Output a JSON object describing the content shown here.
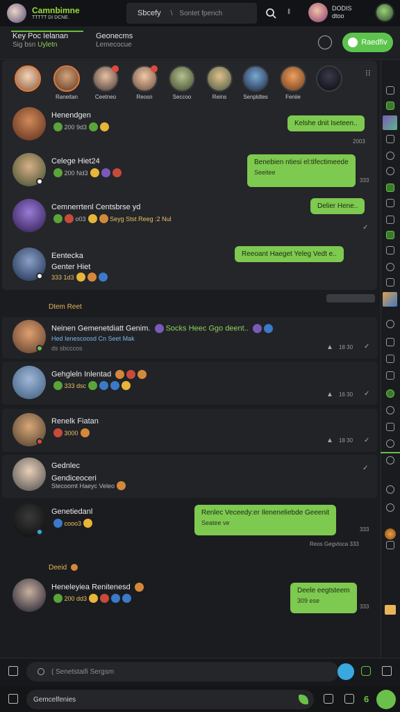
{
  "app": {
    "title": "Camnbimne",
    "subtitle": "TTTTT DI DCNE."
  },
  "topbar": {
    "search_label": "Sbcefy",
    "search_placeholder": "Sontet fpench",
    "search_glyph": "\\",
    "pause_glyph": "‖",
    "user_line1": "DODIS",
    "user_line2": "dtoo"
  },
  "tabs": [
    {
      "line1": "Key Poc Ielanan",
      "line2_a": "Sig bsn",
      "line2_b": "Uyletn"
    },
    {
      "line1": "Geonecms",
      "line2_a": "Lemecocue",
      "line2_b": ""
    }
  ],
  "ready_button": "Raedfiv",
  "stories": [
    {
      "name": ""
    },
    {
      "name": "Raneitan"
    },
    {
      "name": "Ceetneo"
    },
    {
      "name": "Reosn"
    },
    {
      "name": "Seccoo"
    },
    {
      "name": "Reins"
    },
    {
      "name": "Senpldtes"
    },
    {
      "name": "Feniie"
    },
    {
      "name": ""
    }
  ],
  "panel1_chats": [
    {
      "name": "Henendgen",
      "sub": "200 9d3",
      "bubble": "Kelshe dnit Iseteen..",
      "bubble2": "",
      "time": "2003"
    },
    {
      "name": "Celege Hiet24",
      "sub": "200 Nd3",
      "bubble": "Benebien ntiesi el:tifectimeede",
      "bubble2": "Seeitee",
      "time": "333"
    },
    {
      "name": "Cemnerrtenl Centsbrse yd",
      "sub": "o03",
      "sub_extra": "Seyg Stst Reeg :2 Nul",
      "bubble": "Delier Hene..",
      "bubble2": "",
      "time": "✓"
    },
    {
      "name": "Eentecka",
      "name2": "Genter Hiet",
      "sub": "333 1d3",
      "bubble": "Reeoant Haeget Yeleg Vedt  e..",
      "bubble2": "",
      "time": ""
    }
  ],
  "section1": "Dtem Reet",
  "panel2_chats": [
    {
      "name": "Neinen Gemenetdiatt Genim.",
      "name_extra": "Socks Heec Ggo deent..",
      "sub": "Hed Ienescoosd Cn Seet Mak",
      "sub2": "ds sbcccos",
      "meta": "18 30"
    },
    {
      "name": "Gehgleln Inlentad",
      "sub": "333  dsc",
      "meta": "16 30"
    },
    {
      "name": "Renelk Fiatan",
      "sub": "3000",
      "meta": "18 30"
    },
    {
      "name": "Gednlec",
      "name2": "Gendiceoceri",
      "sub": "Stecoomt Haeyc Veleo",
      "meta": "✓"
    },
    {
      "name": "Genetiedanl",
      "sub": "cooo3",
      "bubble": "Renlec Veceedy:er Ileneneliebde Geeenit",
      "bubble2": "Seatee ve",
      "time": "333",
      "meta": "Reos Gegvtoca 333"
    }
  ],
  "section2": "Deeid",
  "panel3_chats": [
    {
      "name": "Heneleyiea Renitenesd",
      "sub": "200 dd3",
      "bubble": "Deele eegtsteem",
      "bubble2": "309 ese",
      "time": "333"
    }
  ],
  "bottom": {
    "search_placeholder": "( Senetstaifi Sergsm",
    "compose_placeholder": "Gemcelfenies",
    "badge_num": "6"
  },
  "colors": {
    "accent_green": "#7ec94f",
    "button_green": "#5cc44d",
    "section_gold": "#e8b65a",
    "background": "#1b1c1f"
  }
}
